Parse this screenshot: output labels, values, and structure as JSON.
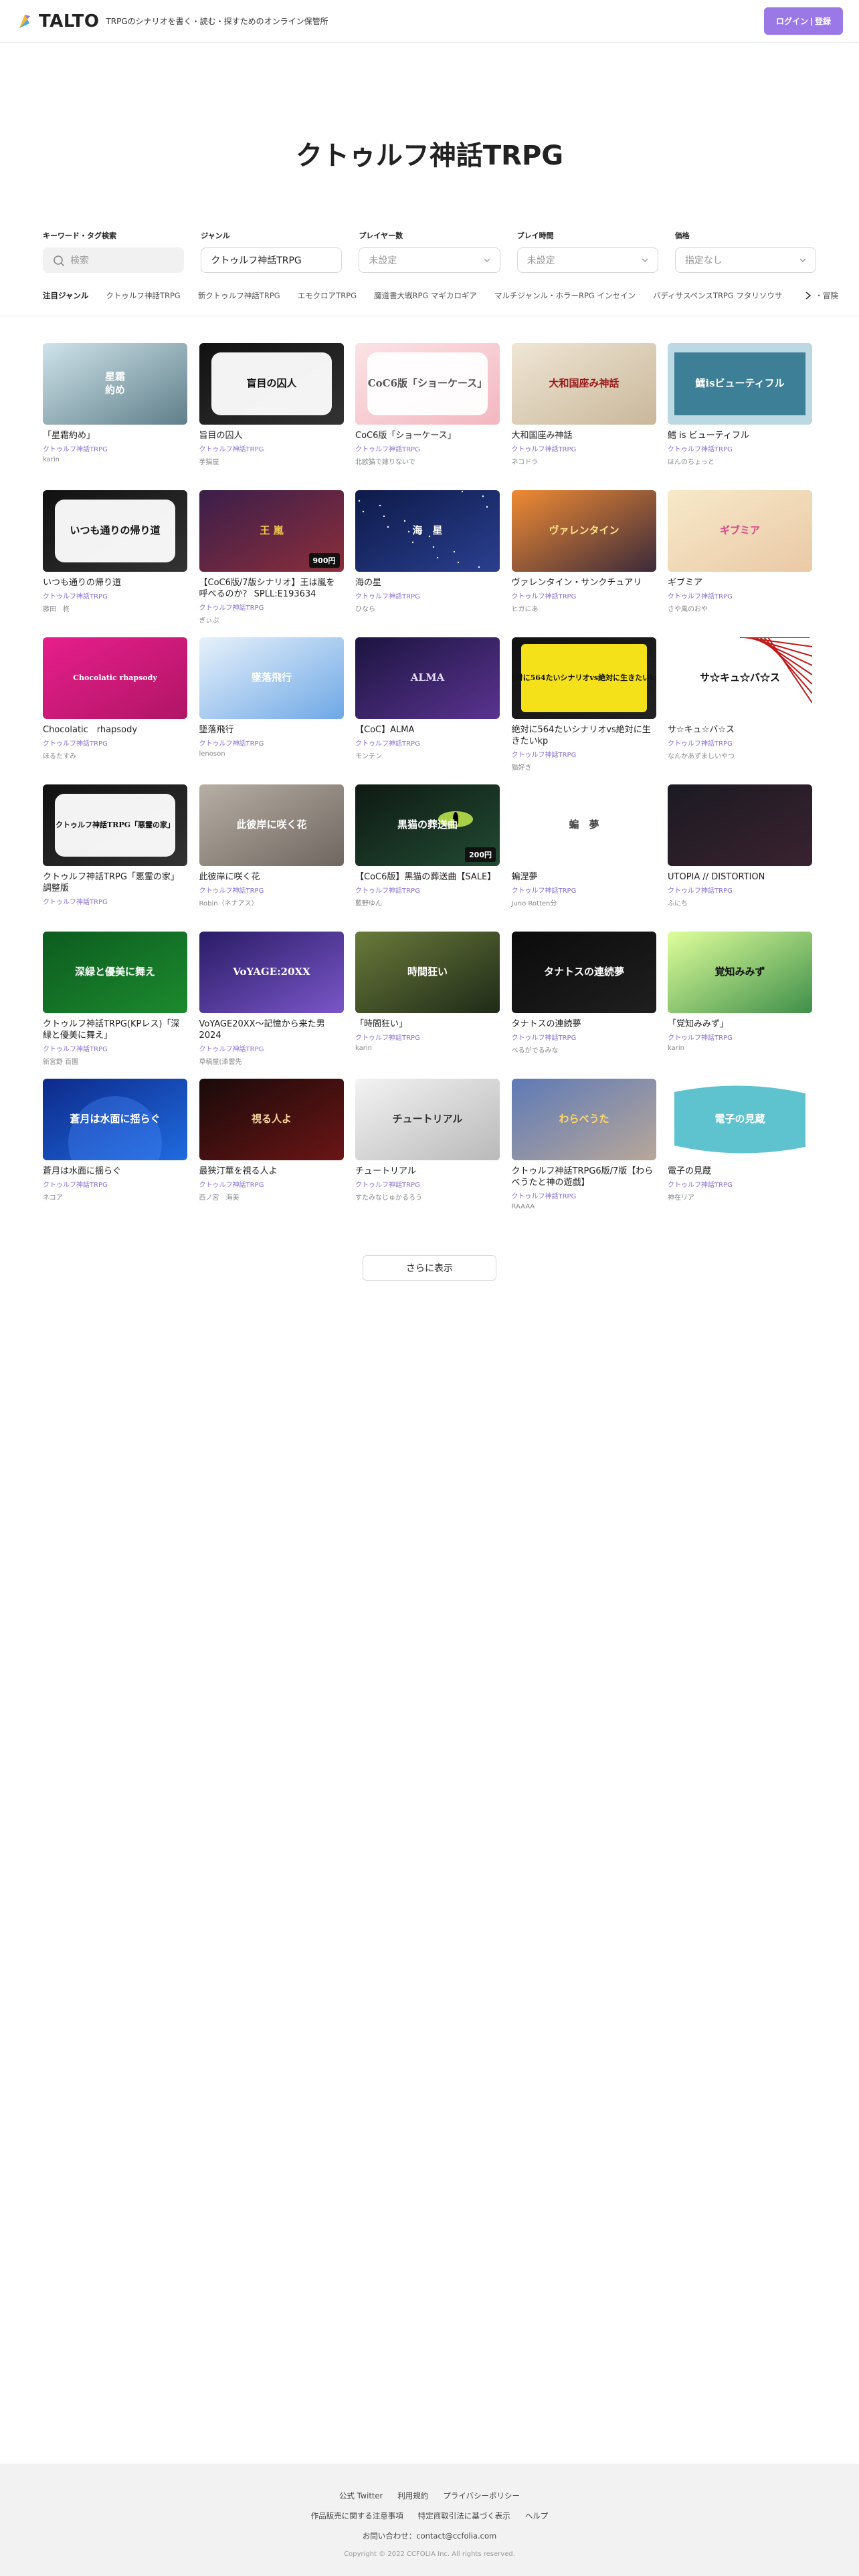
{
  "header": {
    "logo_text": "TALTO",
    "tagline": "TRPGのシナリオを書く・読む・探すためのオンライン保管所",
    "login_label": "ログイン | 登録",
    "brand_color": "#9a79e6"
  },
  "hero": {
    "title": "クトゥルフ神話TRPG"
  },
  "filters": {
    "keyword": {
      "label": "キーワード・タグ検索",
      "placeholder": "検索"
    },
    "genre": {
      "label": "ジャンル",
      "value": "クトゥルフ神話TRPG"
    },
    "players": {
      "label": "プレイヤー数",
      "value": "未設定"
    },
    "playtime": {
      "label": "プレイ時間",
      "value": "未設定"
    },
    "price": {
      "label": "価格",
      "value": "指定なし"
    }
  },
  "genre_row": {
    "title": "注目ジャンル",
    "items": [
      "クトゥルフ神話TRPG",
      "新クトゥルフ神話TRPG",
      "エモクロアTRPG",
      "魔道書大戦RPG マギカロギア",
      "マルチジャンル・ホラーRPG インセイン",
      "パディサスペンスTRPG フタリソウサ",
      "探索・冒険"
    ]
  },
  "cards": [
    {
      "title": "「星霜約め」",
      "genre": "クトゥルフ神話TRPG",
      "author": "karin",
      "price": "",
      "theme": "snow",
      "overlay": "星霜\n約め"
    },
    {
      "title": "旨目の囚人",
      "genre": "クトゥルフ神話TRPG",
      "author": "芋猫屋",
      "price": "",
      "theme": "monoframe",
      "overlay": "盲目の囚人"
    },
    {
      "title": "CoC6版「ショーケース」",
      "genre": "クトゥルフ神話TRPG",
      "author": "北欧猫で嫁りないで",
      "price": "",
      "theme": "pinkframe",
      "overlay": "CoC6版「ショーケース」"
    },
    {
      "title": "大和国座み神話",
      "genre": "クトゥルフ神話TRPG",
      "author": "ネコドラ",
      "price": "",
      "theme": "japan",
      "overlay": "大和国座み神話"
    },
    {
      "title": "鱈 is ビューティフル",
      "genre": "クトゥルフ神話TRPG",
      "author": "ほんのちょっと",
      "price": "",
      "theme": "teal",
      "overlay": "鱈isビューティフル"
    },
    {
      "title": "いつも通りの帰り道",
      "genre": "クトゥルフ神話TRPG",
      "author": "藤田　柊",
      "price": "",
      "theme": "monoframe",
      "overlay": "いつも通りの帰り道"
    },
    {
      "title": "【CoC6版/7版シナリオ】王は嵐を呼べるのか？ SPLL:E193634",
      "genre": "クトゥルフ神話TRPG",
      "author": "ぎぃぷ",
      "price": "900円",
      "theme": "purplestorm",
      "overlay": "王 嵐"
    },
    {
      "title": "海の星",
      "genre": "クトゥルフ神話TRPG",
      "author": "ひなら",
      "price": "",
      "theme": "navystars",
      "overlay": "海　星"
    },
    {
      "title": "ヴァレンタイン・サンクチュアリ",
      "genre": "クトゥルフ神話TRPG",
      "author": "ヒガにあ",
      "price": "",
      "theme": "sunset",
      "overlay": "ヴァレンタイン"
    },
    {
      "title": "ギブミア",
      "genre": "クトゥルフ神話TRPG",
      "author": "さや風のおや",
      "price": "",
      "theme": "candy",
      "overlay": "ギブミア"
    },
    {
      "title": "Chocolatic　rhapsody",
      "genre": "クトゥルフ神話TRPG",
      "author": "ほるたすみ",
      "price": "",
      "theme": "magenta",
      "overlay": "Chocolatic rhapsody"
    },
    {
      "title": "墜落飛行",
      "genre": "クトゥルフ神話TRPG",
      "author": "lenoson",
      "price": "",
      "theme": "sky",
      "overlay": "墜落飛行"
    },
    {
      "title": "【CoC】ALMA",
      "genre": "クトゥルフ神話TRPG",
      "author": "モンテン",
      "price": "",
      "theme": "violet",
      "overlay": "ALMA"
    },
    {
      "title": "絶対に564たいシナリオvs絶対に生きたいkp",
      "genre": "クトゥルフ神話TRPG",
      "author": "猫好き",
      "price": "",
      "theme": "yellowbox",
      "overlay": "絶対に564たいシナリオvs絶対に生きたいkp"
    },
    {
      "title": "サ☆キュ☆バ☆ス",
      "genre": "クトゥルフ神話TRPG",
      "author": "なんかあずましいやつ",
      "price": "",
      "theme": "manga",
      "overlay": "サ☆キュ☆バ☆ス"
    },
    {
      "title": "クトゥルフ神話TRPG「悪霊の家」調整版",
      "genre": "クトゥルフ神話TRPG",
      "author": "",
      "price": "",
      "theme": "monoframe",
      "overlay": "クトゥルフ神話TRPG「悪霊の家」"
    },
    {
      "title": "此彼岸に咲く花",
      "genre": "クトゥルフ神話TRPG",
      "author": "Robin（ネナアス）",
      "price": "",
      "theme": "greyflower",
      "overlay": "此彼岸に咲く花"
    },
    {
      "title": "【CoC6版】黒猫の葬送曲【SALE】",
      "genre": "クトゥルフ神話TRPG",
      "author": "藍野ゆん",
      "price": "200円",
      "theme": "cateye",
      "overlay": "黒猫の葬送曲"
    },
    {
      "title": "蝙涅夢",
      "genre": "クトゥルフ神話TRPG",
      "author": "Juno Rotten分",
      "price": "",
      "theme": "white",
      "overlay": "蝙　夢"
    },
    {
      "title": "UTOPIA // DISTORTION",
      "genre": "クトゥルフ神話TRPG",
      "author": "ふにち",
      "price": "",
      "theme": "crimson",
      "overlay": ""
    },
    {
      "title": "クトゥルフ神話TRPG(KPレス)「深緑と優美に舞え」",
      "genre": "クトゥルフ神話TRPG",
      "author": "新宮野 百園",
      "price": "",
      "theme": "green",
      "overlay": "深緑と優美に舞え"
    },
    {
      "title": "VoYAGE20XX〜記憶から来た男 2024",
      "genre": "クトゥルフ神話TRPG",
      "author": "草稿屋(漆雲先",
      "price": "",
      "theme": "voyage",
      "overlay": "VoYAGE:20XX"
    },
    {
      "title": "「時間狂い」",
      "genre": "クトゥルフ神話TRPG",
      "author": "karin",
      "price": "",
      "theme": "forest",
      "overlay": "時間狂い"
    },
    {
      "title": "タナトスの連続夢",
      "genre": "クトゥルフ神話TRPG",
      "author": "ベるがでるみな",
      "price": "",
      "theme": "blackscript",
      "overlay": "タナトスの連続夢"
    },
    {
      "title": "「覚知みみず」",
      "genre": "クトゥルフ神話TRPG",
      "author": "karin",
      "price": "",
      "theme": "lime",
      "overlay": "覚知みみず"
    },
    {
      "title": "蒼月は水面に揺らぐ",
      "genre": "クトゥルフ神話TRPG",
      "author": "ネコア",
      "price": "",
      "theme": "bluemoon",
      "overlay": "蒼月は水面に揺らぐ"
    },
    {
      "title": "最狭汀華を視る人よ",
      "genre": "クトゥルフ神話TRPG",
      "author": "西ノ宮　海美",
      "price": "",
      "theme": "darkred",
      "overlay": "視る人よ"
    },
    {
      "title": "チュートリアル",
      "genre": "クトゥルフ神話TRPG",
      "author": "すたみなじゅかるろう",
      "price": "",
      "theme": "silver",
      "overlay": "チュートリアル"
    },
    {
      "title": "クトゥルフ神話TRPG6版/7版【わらべうたと神の遊戯】",
      "genre": "クトゥルフ神話TRPG",
      "author": "RAAAA",
      "price": "",
      "theme": "dusk",
      "overlay": "わらべうた"
    },
    {
      "title": "電子の見蔵",
      "genre": "クトゥルフ神話TRPG",
      "author": "神在リア",
      "price": "",
      "theme": "aqua",
      "overlay": "電子の見蔵"
    }
  ],
  "more_label": "さらに表示",
  "footer": {
    "links_row1": [
      "公式 Twitter",
      "利用規約",
      "プライバシーポリシー"
    ],
    "links_row2": [
      "作品販売に関する注意事項",
      "特定商取引法に基づく表示",
      "ヘルプ"
    ],
    "contact": "お問い合わせ：contact@ccfolia.com",
    "copyright": "Copyright © 2022 CCFOLIA Inc. All rights reserved."
  }
}
